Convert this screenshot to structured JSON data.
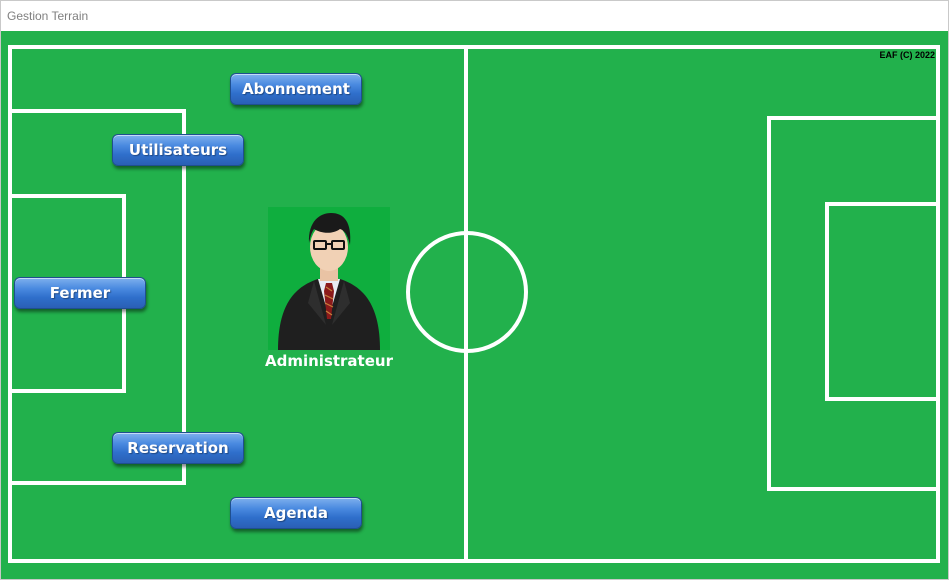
{
  "window": {
    "title": "Gestion Terrain"
  },
  "field": {
    "copyright": "EAF (C) 2022"
  },
  "menu": {
    "abonnement": "Abonnement",
    "utilisateurs": "Utilisateurs",
    "fermer": "Fermer",
    "reservation": "Reservation",
    "agenda": "Agenda"
  },
  "user": {
    "role": "Administrateur",
    "avatar_icon": "businessman-avatar-icon"
  },
  "colors": {
    "pitch": "#22b14c",
    "lines": "#ffffff",
    "button": "#3a7bd5",
    "avatar_bg": "#0fae3e"
  }
}
